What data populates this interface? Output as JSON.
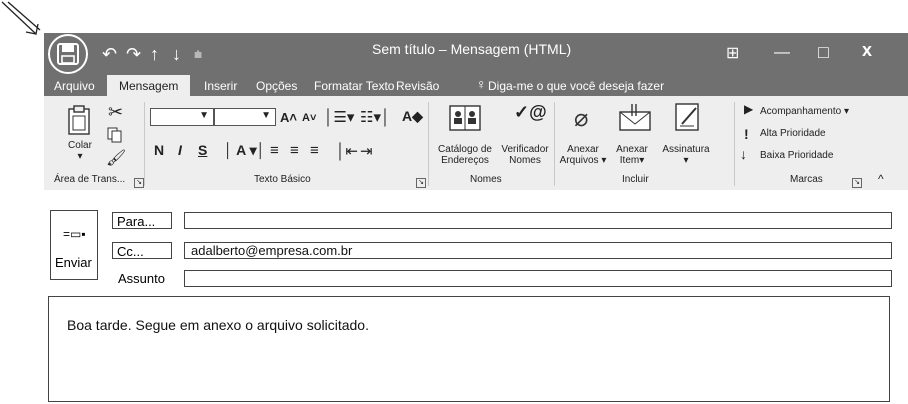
{
  "window": {
    "title": "Sem título – Mensagem (HTML)",
    "qat_icons": [
      "save-icon",
      "undo-icon",
      "redo-icon",
      "up-arrow-icon",
      "down-arrow-icon",
      "customize-qat-icon"
    ],
    "controls": {
      "restore_icon": "⊞",
      "minimize": "—",
      "maximize": "□",
      "close": "x"
    }
  },
  "tabs": [
    {
      "label": "Arquivo"
    },
    {
      "label": "Mensagem",
      "active": true
    },
    {
      "label": "Inserir"
    },
    {
      "label": "Opções"
    },
    {
      "label": "Formatar Texto"
    },
    {
      "label": "Revisão"
    }
  ],
  "tell_me": "Diga-me o que você deseja fazer",
  "ribbon": {
    "clipboard": {
      "paste_label": "Colar",
      "group": "Área de Trans..."
    },
    "basic_text": {
      "group": "Texto Básico",
      "font_value": "",
      "size_value": "",
      "bold": "N",
      "italic": "I",
      "underline": "S"
    },
    "names": {
      "group": "Nomes",
      "address_book": [
        "Catálogo de",
        "Endereços"
      ],
      "check_names": [
        "Verificador",
        "Nomes"
      ]
    },
    "include": {
      "group": "Incluir",
      "attach_file": [
        "Anexar",
        "Arquivos ▾"
      ],
      "attach_item": [
        "Anexar",
        "Item▾"
      ],
      "signature": [
        "Assinatura",
        "▾"
      ]
    },
    "tags": {
      "group": "Marcas",
      "follow_up": "Acompanhamento ▾",
      "high": "Alta Prioridade",
      "low": "Baixa Prioridade"
    }
  },
  "compose": {
    "send": "Enviar",
    "to_label": "Para...",
    "cc_label": "Cc...",
    "subject_label": "Assunto",
    "to_value": "",
    "cc_value": "adalberto@empresa.com.br",
    "subject_value": "",
    "body": "Boa tarde. Segue em anexo o arquivo solicitado."
  }
}
